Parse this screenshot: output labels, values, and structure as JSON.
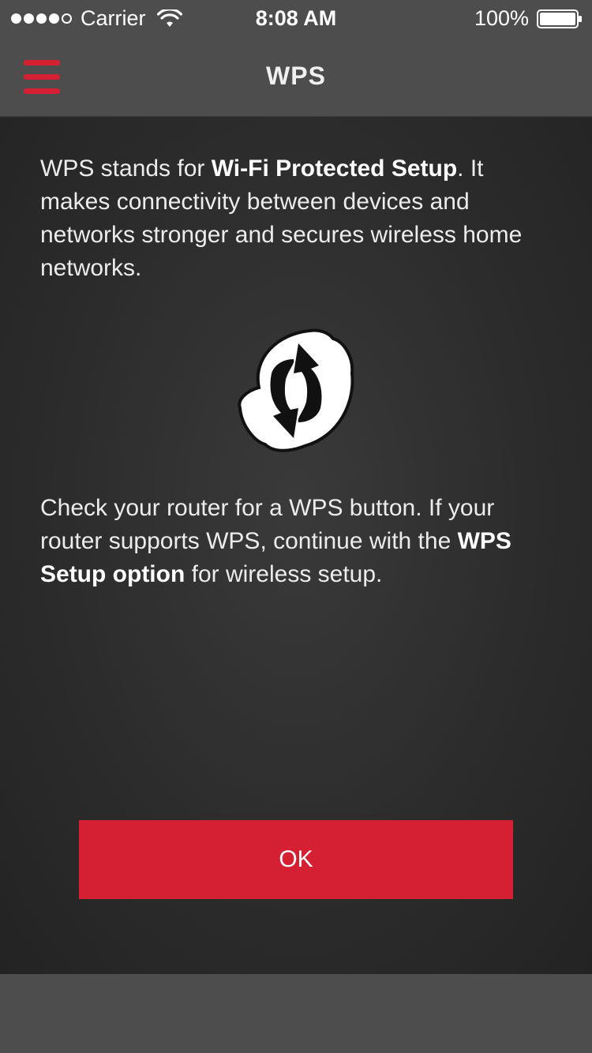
{
  "status_bar": {
    "carrier": "Carrier",
    "time": "8:08 AM",
    "battery": "100%",
    "signal_bars": 4,
    "signal_max": 5
  },
  "nav": {
    "title": "WPS",
    "menu_icon": "hamburger-menu-icon"
  },
  "content": {
    "intro": {
      "before": "WPS stands for ",
      "bold": "Wi-Fi Protected Setup",
      "after": ". It makes connectivity between devices and networks stronger and secures wireless home networks."
    },
    "wps_icon": "wps-icon",
    "instruction": {
      "before": "Check your router for a WPS button. If your router supports WPS, continue with the ",
      "bold": "WPS Setup option",
      "after": " for wireless setup."
    },
    "ok_label": "OK"
  },
  "colors": {
    "accent": "#d42032",
    "bar": "#4d4d4d",
    "background": "#2b2b2b"
  }
}
